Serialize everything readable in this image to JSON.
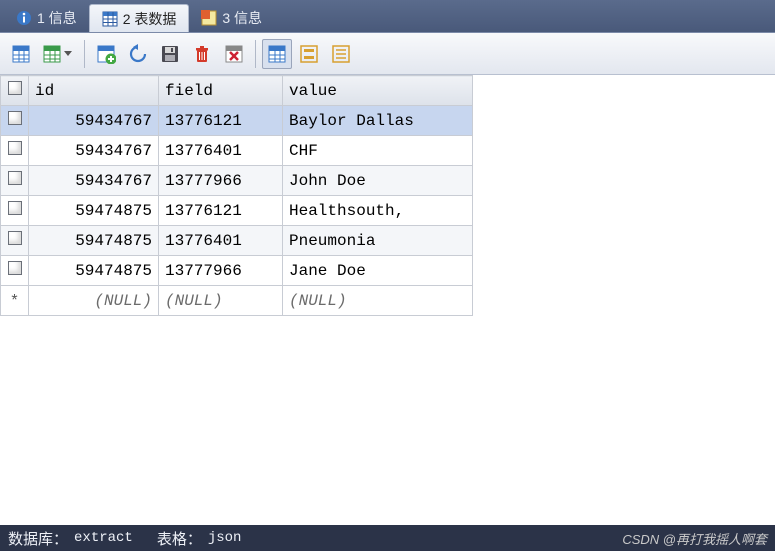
{
  "tabs": [
    {
      "label": "1 信息",
      "icon": "info-icon"
    },
    {
      "label": "2 表数据",
      "icon": "grid-icon"
    },
    {
      "label": "3 信息",
      "icon": "yellow-grid-icon"
    }
  ],
  "active_tab_index": 1,
  "table": {
    "columns": [
      "id",
      "field",
      "value"
    ],
    "rows": [
      {
        "id": "59434767",
        "field": "13776121",
        "value": "Baylor Dallas",
        "selected": true
      },
      {
        "id": "59434767",
        "field": "13776401",
        "value": "CHF"
      },
      {
        "id": "59434767",
        "field": "13777966",
        "value": "John Doe"
      },
      {
        "id": "59474875",
        "field": "13776121",
        "value": "Healthsouth,"
      },
      {
        "id": "59474875",
        "field": "13776401",
        "value": "Pneumonia"
      },
      {
        "id": "59474875",
        "field": "13777966",
        "value": "Jane Doe"
      }
    ],
    "new_row": {
      "id": "(NULL)",
      "field": "(NULL)",
      "value": "(NULL)",
      "marker": "*"
    }
  },
  "status": {
    "db_label": "数据库：",
    "db_value": "extract",
    "table_label": "表格：",
    "table_value": "json"
  },
  "watermark": "CSDN @再打我摇人啊套"
}
